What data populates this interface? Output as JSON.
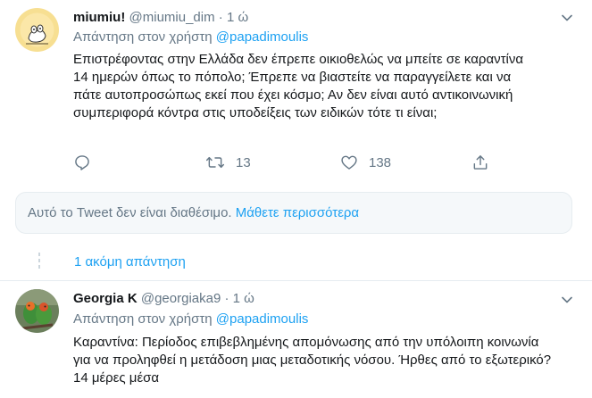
{
  "tweet1": {
    "display_name": "miumiu!",
    "handle": "@miumiu_dim",
    "separator": "·",
    "time": "1 ώ",
    "reply_prefix": "Απάντηση στον χρήστη",
    "reply_mention": "@papadimoulis",
    "text": "Επιστρέφοντας στην Ελλάδα δεν έπρεπε οικιοθελώς να μπείτε σε καραντίνα 14 ημερών όπως το πόπολο; Έπρεπε να βιαστείτε να παραγγείλετε και να πάτε αυτοπροσώπως εκεί που έχει κόσμο; Αν δεν είναι αυτό αντικοινωνική συμπεριφορά κόντρα στις υποδείξεις των ειδικών τότε τι είναι;",
    "retweet_count": "13",
    "like_count": "138"
  },
  "unavailable": {
    "message": "Αυτό το Tweet δεν είναι διαθέσιμο.",
    "link": "Μάθετε περισσότερα"
  },
  "more_replies": "1 ακόμη απάντηση",
  "tweet2": {
    "display_name": "Georgia K",
    "handle": "@georgiaka9",
    "separator": "·",
    "time": "1 ώ",
    "reply_prefix": "Απάντηση στον χρήστη",
    "reply_mention": "@papadimoulis",
    "text": "Καραντίνα: Περίοδος επιβεβλημένης απομόνωσης από την υπόλοιπη κοινωνία για να προληφθεί η μετάδοση μιας μεταδοτικής νόσου.  Ήρθες από το εξωτερικό? 14 μέρες μέσα"
  },
  "colors": {
    "accent": "#1da1f2",
    "secondary_text": "#657786",
    "primary_text": "#14171a",
    "border": "#e6ecf0"
  },
  "icons": [
    "caret-down-icon",
    "reply-icon",
    "retweet-icon",
    "like-icon",
    "share-icon"
  ]
}
